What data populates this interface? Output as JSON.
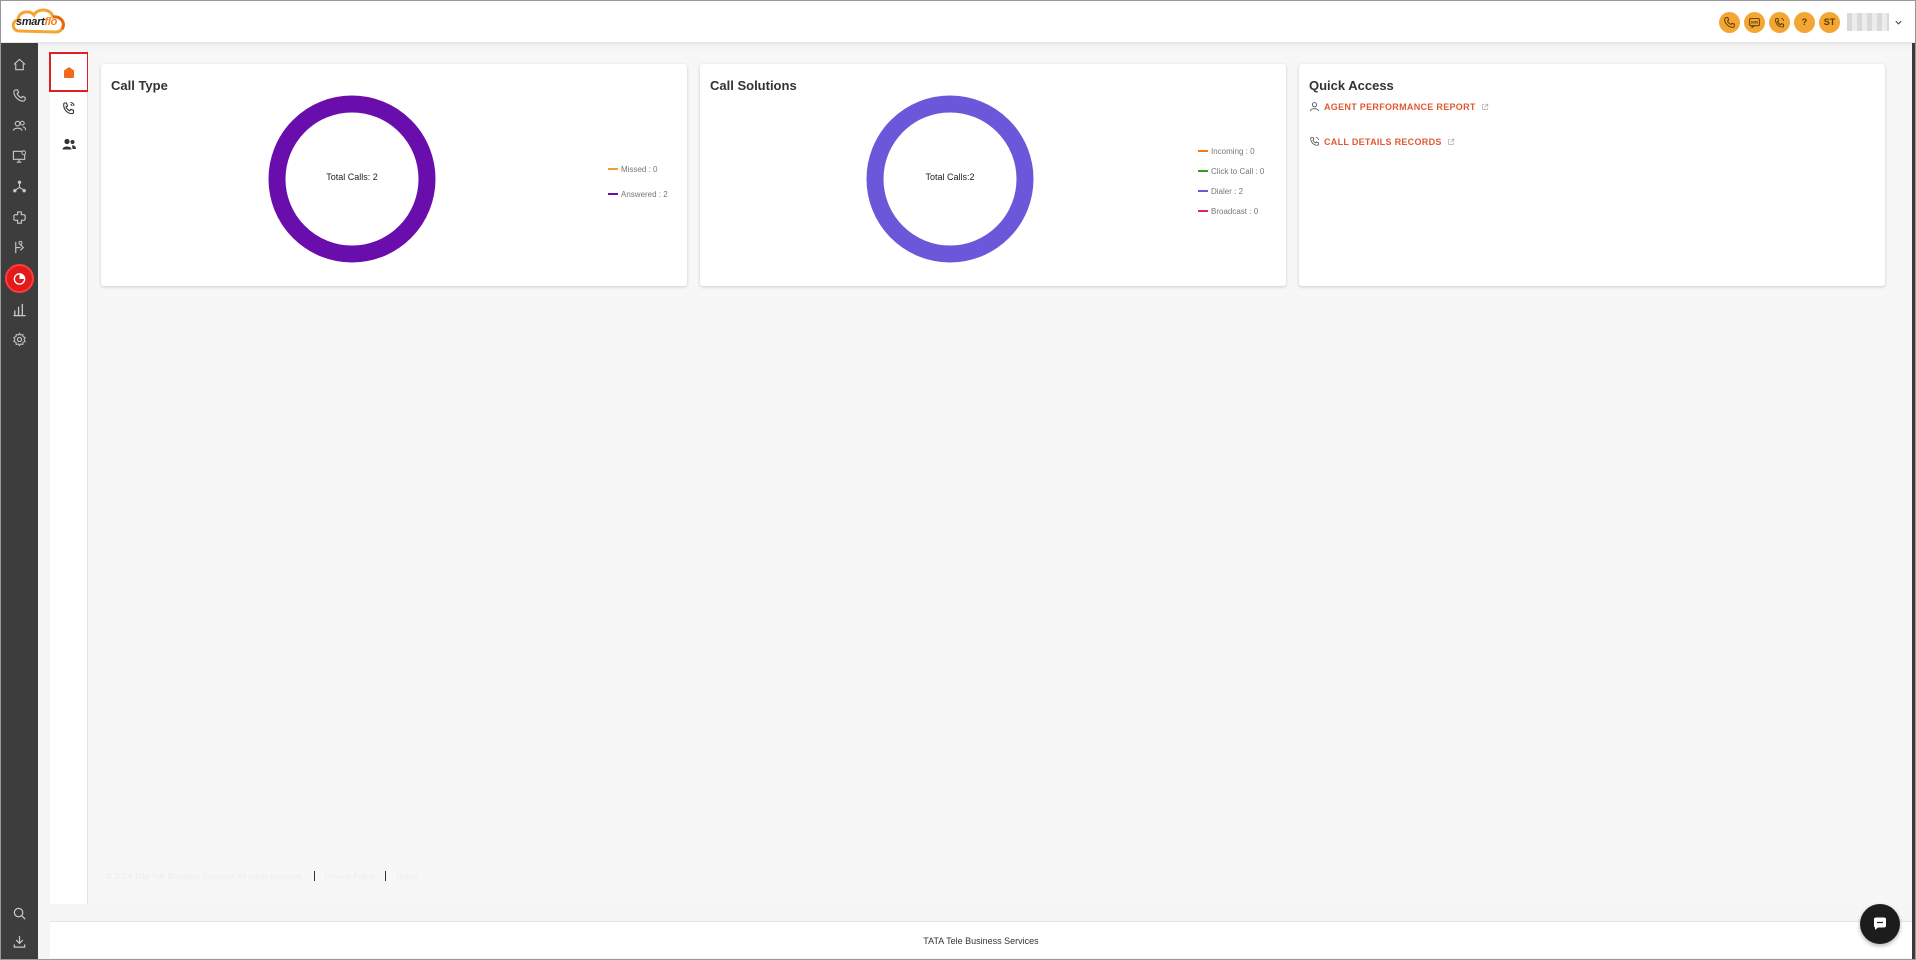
{
  "app": {
    "logo_prefix": "smart",
    "logo_suffix": "flo"
  },
  "header": {
    "user_initials": "ST",
    "help_label": "?",
    "sms_label": "SMS",
    "accent_color": "#f3a634"
  },
  "rail": {
    "items": [
      {
        "name": "home",
        "icon": "home-icon"
      },
      {
        "name": "calls",
        "icon": "phone-icon"
      },
      {
        "name": "users",
        "icon": "users-icon"
      },
      {
        "name": "monitor",
        "icon": "monitor-icon"
      },
      {
        "name": "network",
        "icon": "network-icon"
      },
      {
        "name": "integrations",
        "icon": "puzzle-icon"
      },
      {
        "name": "routing",
        "icon": "routing-icon"
      },
      {
        "name": "dashboard",
        "icon": "dashboard-icon",
        "active": true
      },
      {
        "name": "reports",
        "icon": "bar-chart-icon"
      },
      {
        "name": "settings",
        "icon": "gear-icon"
      },
      {
        "name": "search",
        "icon": "search-icon"
      },
      {
        "name": "download",
        "icon": "download-icon"
      }
    ],
    "active_color": "#e11b1b"
  },
  "subbar": {
    "items": [
      {
        "name": "overview",
        "icon": "home-icon",
        "active": true
      },
      {
        "name": "call-activity",
        "icon": "phone-ring-icon"
      },
      {
        "name": "agents",
        "icon": "agents-icon"
      }
    ]
  },
  "call_type": {
    "title": "Call Type",
    "center_label": "Total Calls: 2",
    "legend": [
      {
        "label": "Missed : 0",
        "color": "#f0a030"
      },
      {
        "label": "Answered : 2",
        "color": "#6a0dad"
      }
    ]
  },
  "call_solutions": {
    "title": "Call Solutions",
    "center_label": "Total Calls:2",
    "legend": [
      {
        "label": "Incoming : 0",
        "color": "#f07b1a"
      },
      {
        "label": "Click to Call : 0",
        "color": "#3a9a1a"
      },
      {
        "label": "Dialer : 2",
        "color": "#6b57d9"
      },
      {
        "label": "Broadcast : 0",
        "color": "#e0245e"
      }
    ]
  },
  "quick_access": {
    "title": "Quick Access",
    "links": [
      {
        "label": "AGENT PERFORMANCE REPORT",
        "icon": "user-icon"
      },
      {
        "label": "CALL DETAILS RECORDS",
        "icon": "phone-icon"
      }
    ]
  },
  "footer": {
    "copyright": "© 2024 Tata Tele Business Services. All rights reserved.",
    "link_1": "Privacy Policy",
    "link_2": "Terms"
  },
  "bottom_bar": {
    "text": "TATA Tele Business Services"
  }
}
